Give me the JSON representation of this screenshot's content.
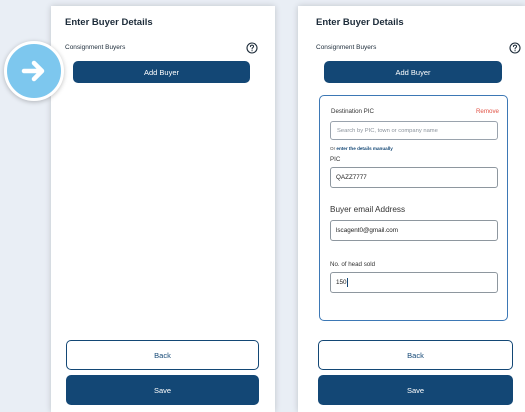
{
  "panels": [
    {
      "title": "Enter Buyer Details",
      "section_label": "Consignment Buyers",
      "help_icon": "question-circle-icon",
      "add_button": "Add Buyer",
      "back_button": "Back",
      "save_button": "Save"
    },
    {
      "title": "Enter Buyer Details",
      "section_label": "Consignment Buyers",
      "help_icon": "question-circle-icon",
      "add_button": "Add Buyer",
      "back_button": "Back",
      "save_button": "Save",
      "buyer_card": {
        "destination_label": "Destination PIC",
        "remove_label": "Remove",
        "search_placeholder": "Search by PIC, town or company name",
        "manual_prefix": "Or ",
        "manual_link": "enter the details manually",
        "pic_label": "PIC",
        "pic_value": "QAZZ7777",
        "email_label": "Buyer email Address",
        "email_value": "lscagent0@gmail.com",
        "head_label": "No. of head sold",
        "head_value": "150"
      }
    }
  ],
  "overlay": {
    "icon": "arrow-right-icon"
  },
  "colors": {
    "primary": "#134775",
    "accent_border": "#3d78b5",
    "remove": "#e15346",
    "badge": "#7dc7ee",
    "background": "#e9eef5"
  }
}
